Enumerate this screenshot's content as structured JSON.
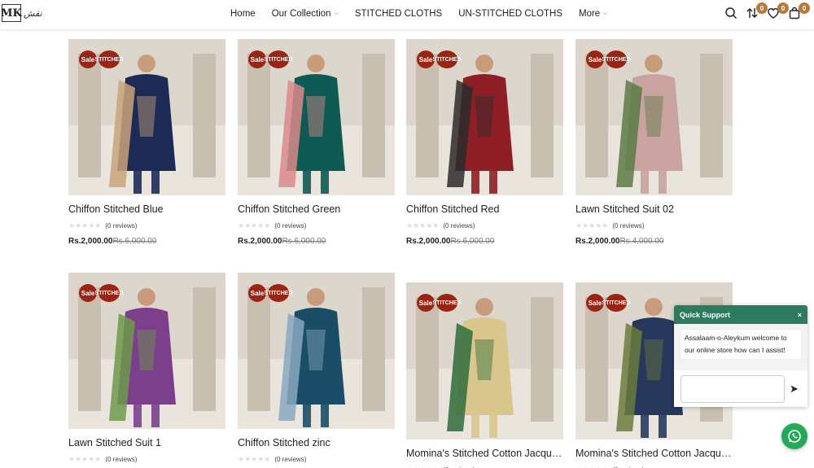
{
  "header": {
    "logo_text": "MK",
    "logo_script": "نقش",
    "nav": [
      {
        "label": "Home",
        "has_dropdown": false
      },
      {
        "label": "Our Collection",
        "has_dropdown": true
      },
      {
        "label": "STITCHED CLOTHS",
        "has_dropdown": false
      },
      {
        "label": "UN-STITCHED CLOTHS",
        "has_dropdown": false
      },
      {
        "label": "More",
        "has_dropdown": true
      }
    ],
    "icons": {
      "search": "search-icon",
      "compare": "compare-icon",
      "compare_count": "0",
      "wishlist": "heart-icon",
      "wishlist_count": "0",
      "cart": "bag-icon",
      "cart_count": "0"
    }
  },
  "labels": {
    "sale": "Sale",
    "stitched": "STITCHED",
    "reviews": "(0 reviews)"
  },
  "products": [
    {
      "name": "Chiffon Stitched Blue",
      "price": "Rs.2,000.00",
      "old_price": "Rs.6,000.00",
      "bg": "#1d2a56",
      "accent": "#c9a57a"
    },
    {
      "name": "Chiffon Stitched Green",
      "price": "Rs.2,000.00",
      "old_price": "Rs.6,000.00",
      "bg": "#0f5a55",
      "accent": "#d98a8a"
    },
    {
      "name": "Chiffon Stitched Red",
      "price": "Rs.2,000.00",
      "old_price": "Rs.6,000.00",
      "bg": "#8e1f27",
      "accent": "#2b2b2b"
    },
    {
      "name": "Lawn Stitched Suit 02",
      "price": "Rs.2,000.00",
      "old_price": "Rs.4,000.00",
      "bg": "#c8a3a0",
      "accent": "#5c7b45"
    },
    {
      "name": "Lawn Stitched Suit 1",
      "price": "",
      "old_price": "",
      "bg": "#7b3f8c",
      "accent": "#6c9a4a"
    },
    {
      "name": "Chiffon Stitched zinc",
      "price": "",
      "old_price": "",
      "bg": "#1a4d66",
      "accent": "#8aa8c0"
    },
    {
      "name": "Momina's Stitched Cotton Jacquard…",
      "price": "",
      "old_price": "",
      "bg": "#d9c68c",
      "accent": "#2f6b3a"
    },
    {
      "name": "Momina's Stitched Cotton Jacquard…",
      "price": "",
      "old_price": "",
      "bg": "#27385c",
      "accent": "#6b7b3c"
    }
  ],
  "support": {
    "title": "Quick Support",
    "close": "×",
    "message": "Assalaam-o-Aleykum welcome to our online store how can I assist!",
    "input_placeholder": ""
  }
}
